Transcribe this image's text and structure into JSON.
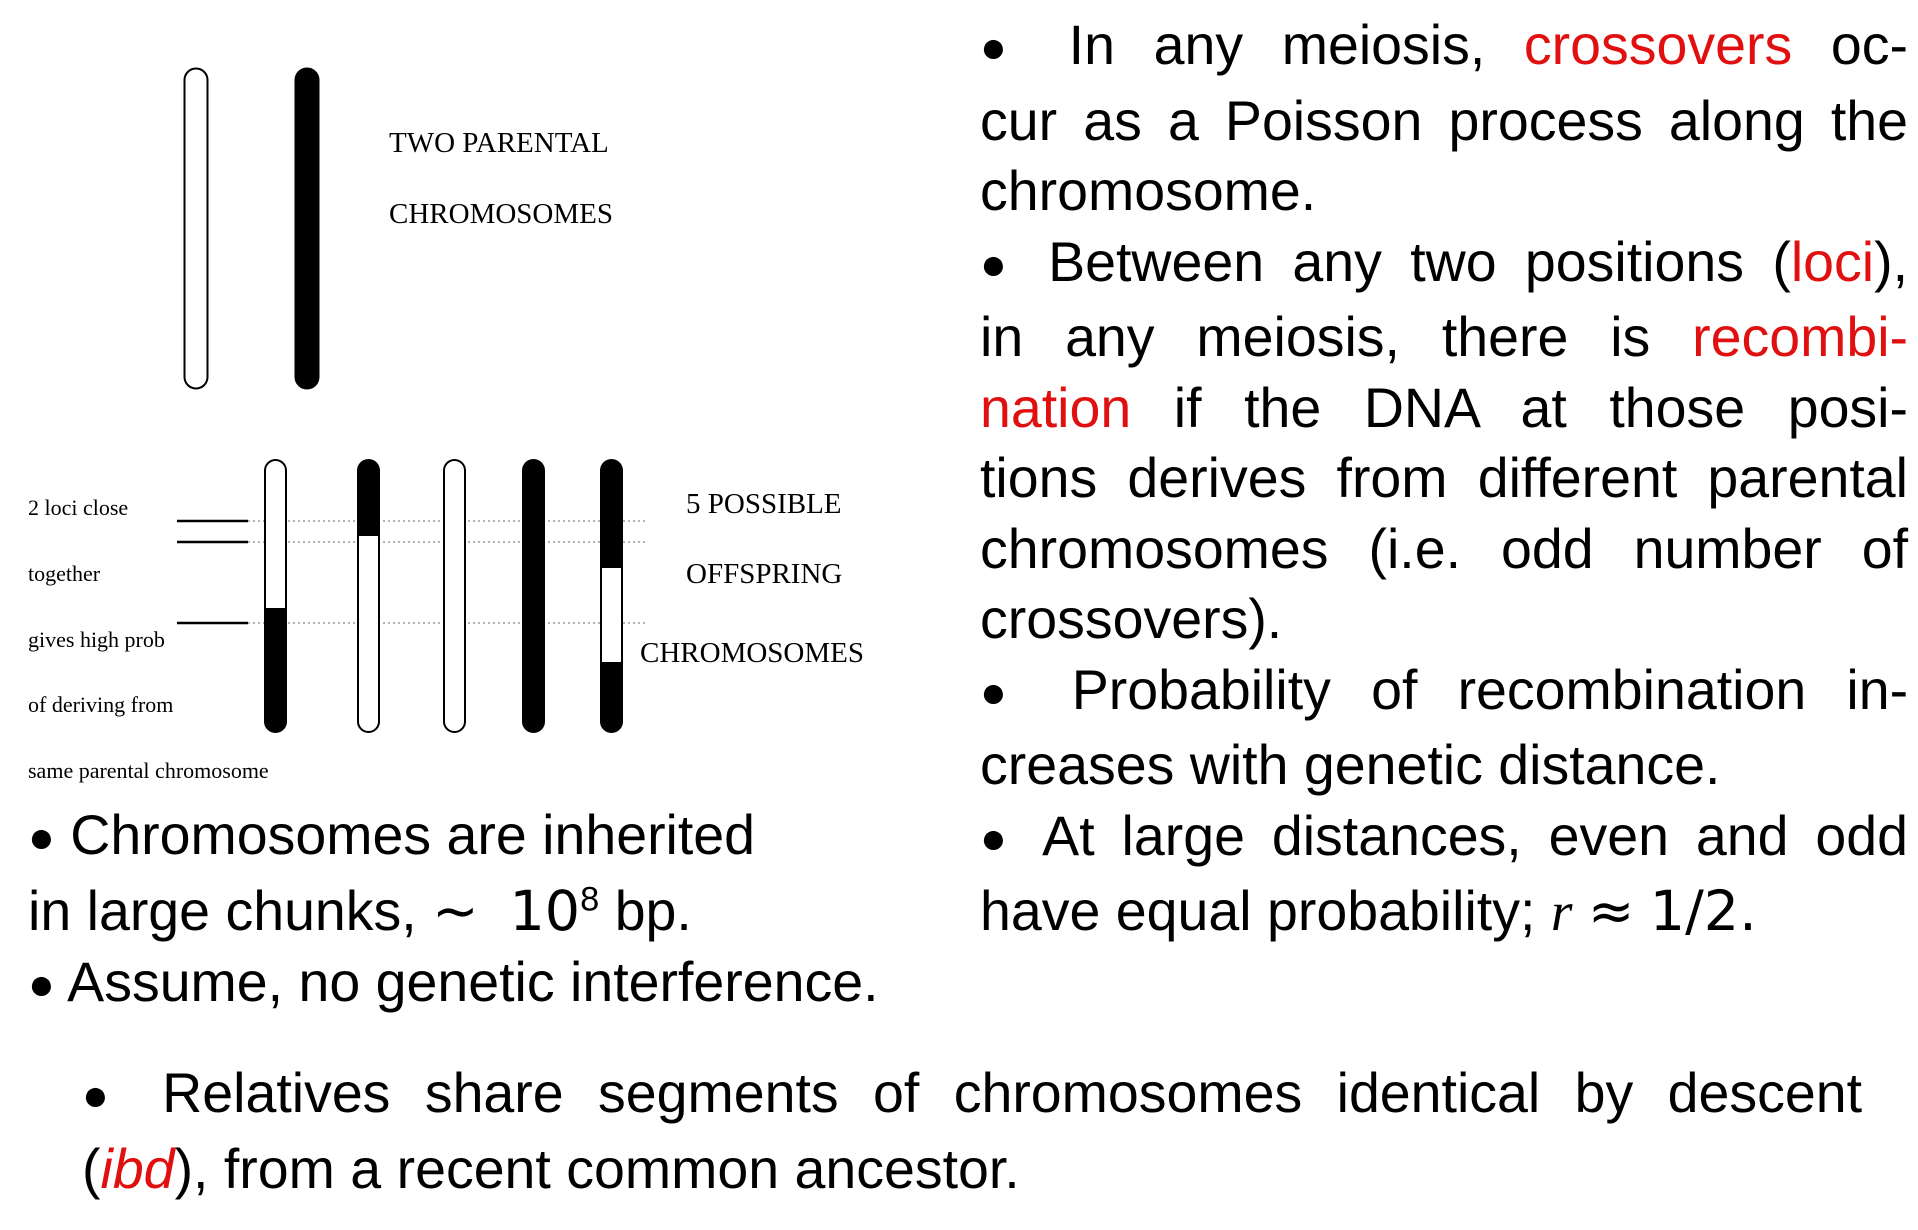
{
  "diagram": {
    "parental_label_line1": "TWO PARENTAL",
    "parental_label_line2": "CHROMOSOMES",
    "offspring_label_line1": "5 POSSIBLE",
    "offspring_label_line2": "OFFSPRING",
    "offspring_label_line3": "CHROMOSOMES",
    "loci_caption": [
      "2 loci  close",
      "together",
      "gives high prob",
      "of deriving from",
      "same parental chromosome"
    ]
  },
  "left_bullets": {
    "b1_line1": "Chromosomes are inherited",
    "b1_line2_pre": "in large chunks,",
    "b1_tilde": "∼",
    "b1_base": "10",
    "b1_exp": "8",
    "b1_unit": "bp.",
    "b2": "Assume, no genetic interference."
  },
  "right_bullets": {
    "p1_l1_a": "In",
    "p1_l1_b": "any",
    "p1_l1_c": "meiosis,",
    "p1_l1_red": "crossovers",
    "p1_l1_e": "oc-",
    "p1_l2": "cur as a Poisson process along the",
    "p1_l3": "chromosome.",
    "p2_l1_pre": "Between any two positions (",
    "p2_l1_red": "loci",
    "p2_l1_post": "),",
    "p2_l2_a": "in",
    "p2_l2_b": "any",
    "p2_l2_c": "meiosis,",
    "p2_l2_d": "there",
    "p2_l2_e": "is",
    "p2_l2_red": "recombi-",
    "p2_l3_red": "nation",
    "p2_l3_a": "if",
    "p2_l3_b": "the",
    "p2_l3_c": "DNA",
    "p2_l3_d": "at",
    "p2_l3_e": "those",
    "p2_l3_f": "posi-",
    "p2_l4": "tions derives from different parental",
    "p2_l5_a": "chromosomes",
    "p2_l5_b": "(i.e.",
    "p2_l5_c": "odd",
    "p2_l5_d": "number",
    "p2_l5_e": "of",
    "p2_l6": "crossovers).",
    "p3_l1_a": "Probability",
    "p3_l1_b": "of",
    "p3_l1_c": "recombination",
    "p3_l1_d": "in-",
    "p3_l2": "creases with genetic distance.",
    "p4_l1": "At large distances, even and odd",
    "p4_l2_pre": "have equal probability;",
    "p4_var": "r",
    "p4_approx": "≈",
    "p4_val": "1/2."
  },
  "bottom": {
    "l1": "Relatives share segments of chromosomes identical by descent",
    "l2_open": "(",
    "l2_red": "ibd",
    "l2_rest": "), from a recent common ancestor."
  },
  "bullet_symbol": "●",
  "colors": {
    "highlight": "#e01010",
    "text": "#000000",
    "chromosome_fill": "#000000",
    "chromosome_outline": "#000000"
  }
}
